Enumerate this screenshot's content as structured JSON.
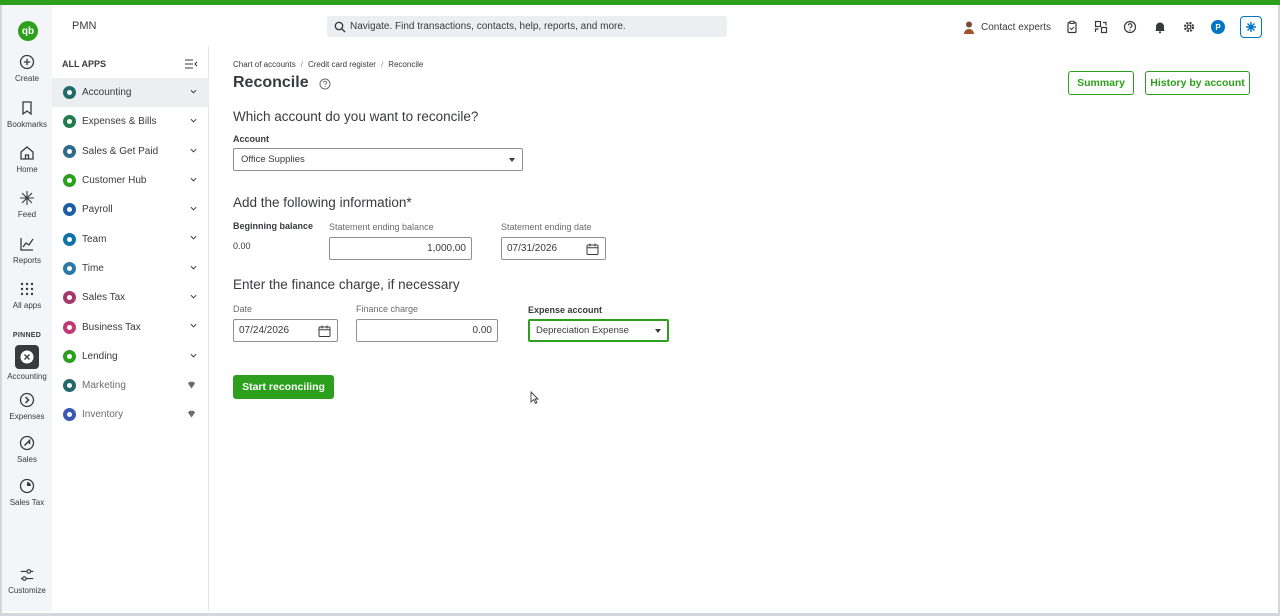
{
  "header": {
    "company": "PMN",
    "search_placeholder": "Navigate. Find transactions, contacts, help, reports, and more.",
    "contact_label": "Contact experts",
    "avatar_initial": "P",
    "brand_color": "#2ca01c"
  },
  "rail": {
    "logo": "qb",
    "items": [
      {
        "label": "Create",
        "icon": "plus-circle-icon"
      },
      {
        "label": "Bookmarks",
        "icon": "bookmark-icon"
      },
      {
        "label": "Home",
        "icon": "home-icon"
      },
      {
        "label": "Feed",
        "icon": "sparkle-icon"
      },
      {
        "label": "Reports",
        "icon": "line-chart-icon"
      },
      {
        "label": "All apps",
        "icon": "grid-icon"
      }
    ],
    "pinned_label": "PINNED",
    "pinned": [
      {
        "label": "Accounting",
        "icon": "accounting-icon"
      },
      {
        "label": "Expenses",
        "icon": "expenses-icon"
      },
      {
        "label": "Sales",
        "icon": "sales-icon"
      },
      {
        "label": "Sales Tax",
        "icon": "sales-tax-icon"
      }
    ],
    "customize_label": "Customize"
  },
  "sidebar": {
    "heading": "ALL APPS",
    "items": [
      {
        "label": "Accounting",
        "color": "#236a6a",
        "active": true
      },
      {
        "label": "Expenses & Bills",
        "color": "#1f7a4d"
      },
      {
        "label": "Sales & Get Paid",
        "color": "#2e6c8a"
      },
      {
        "label": "Customer Hub",
        "color": "#2ca01c"
      },
      {
        "label": "Payroll",
        "color": "#1b5fa6"
      },
      {
        "label": "Team",
        "color": "#0d73a8"
      },
      {
        "label": "Time",
        "color": "#2a7aa8"
      },
      {
        "label": "Sales Tax",
        "color": "#a43a6b"
      },
      {
        "label": "Business Tax",
        "color": "#c23a73"
      },
      {
        "label": "Lending",
        "color": "#2ca01c"
      },
      {
        "label": "Marketing",
        "color": "#236a6a",
        "premium": true
      },
      {
        "label": "Inventory",
        "color": "#3a58b8",
        "premium": true
      }
    ]
  },
  "page": {
    "breadcrumb": [
      "Chart of accounts",
      "Credit card register",
      "Reconcile"
    ],
    "title": "Reconcile",
    "summary_btn": "Summary",
    "history_btn": "History by account",
    "q1": "Which account do you want to reconcile?",
    "account_label": "Account",
    "account_value": "Office Supplies",
    "q2": "Add the following information*",
    "beginning_label": "Beginning balance",
    "beginning_value": "0.00",
    "stmt_balance_label": "Statement ending balance",
    "stmt_balance_value": "1,000.00",
    "stmt_date_label": "Statement ending date",
    "stmt_date_value": "07/31/2026",
    "q3": "Enter the finance charge, if necessary",
    "date_label": "Date",
    "date_value": "07/24/2026",
    "finance_label": "Finance charge",
    "finance_value": "0.00",
    "expense_label": "Expense account",
    "expense_value": "Depreciation Expense",
    "start_btn": "Start reconciling"
  }
}
